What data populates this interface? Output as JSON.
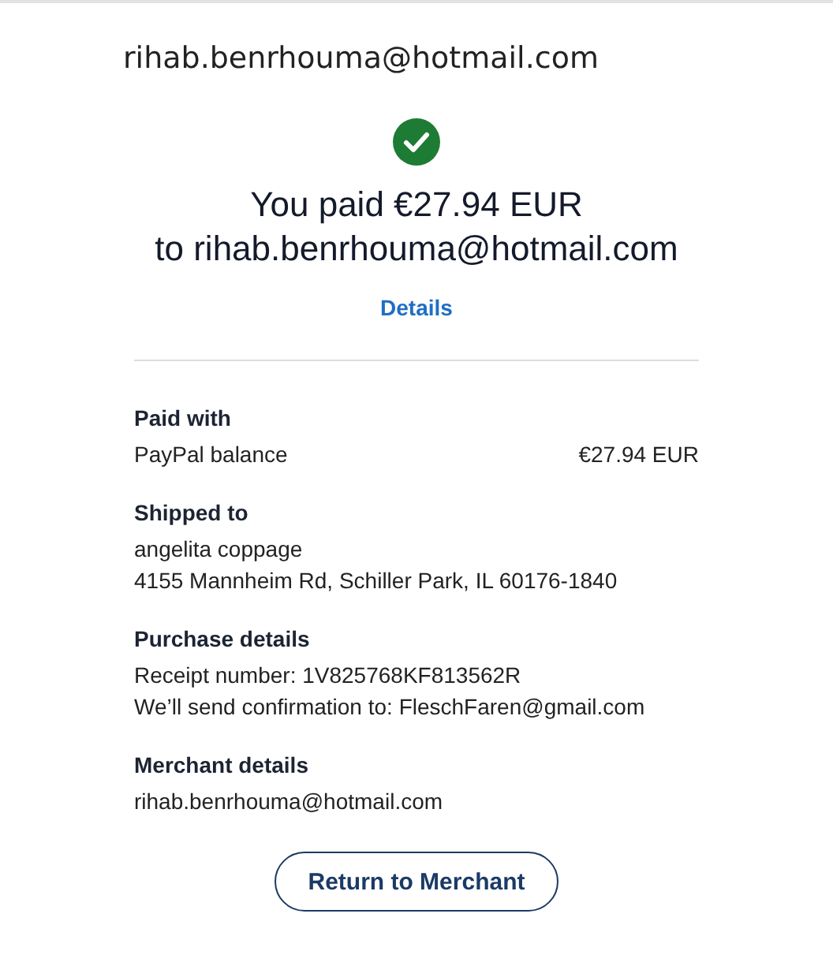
{
  "account": "rihab.benrhouma@hotmail.com",
  "title": [
    "You paid €27.94 EUR",
    "to rihab.benrhouma@hotmail.com"
  ],
  "details_link": "Details",
  "sections": [
    {
      "heading": "Paid with",
      "lines": [
        {
          "text": "PayPal balance",
          "amount": "€27.94 EUR"
        }
      ]
    },
    {
      "heading": "Shipped to",
      "lines": [
        {
          "text": "angelita coppage"
        },
        {
          "text": "4155 Mannheim Rd, Schiller Park, IL 60176-1840"
        }
      ]
    },
    {
      "heading": "Purchase details",
      "lines": [
        {
          "text": "Receipt number: 1V825768KF813562R"
        },
        {
          "text": "We’ll send confirmation to: FleschFaren@gmail.com"
        }
      ]
    },
    {
      "heading": "Merchant details",
      "lines": [
        {
          "text": "rihab.benrhouma@hotmail.com"
        }
      ]
    }
  ],
  "button": "Return to Merchant"
}
